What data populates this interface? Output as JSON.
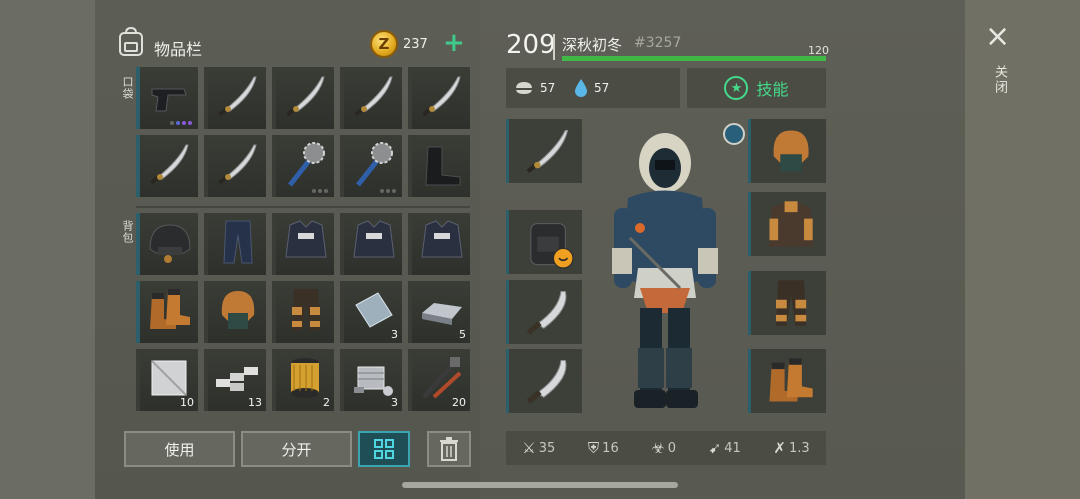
{
  "inventory": {
    "title": "物品栏",
    "coin_symbol": "Z",
    "coins": "237",
    "add_symbol": "+",
    "pocket_label": "口袋",
    "backpack_label": "背包",
    "pocket_items": [
      {
        "icon": "pistol-icon",
        "count": "",
        "dots": [
          "#666",
          "#5a6ad8",
          "#8a5ad8",
          "#8a5ad8"
        ]
      },
      {
        "icon": "katana-icon",
        "count": ""
      },
      {
        "icon": "katana-icon",
        "count": ""
      },
      {
        "icon": "katana-icon",
        "count": ""
      },
      {
        "icon": "katana-icon",
        "count": ""
      },
      {
        "icon": "katana-icon",
        "count": ""
      },
      {
        "icon": "katana-icon",
        "count": ""
      },
      {
        "icon": "spiked-mace-icon",
        "count": "",
        "dots": [
          "#666",
          "#666",
          "#666"
        ]
      },
      {
        "icon": "spiked-mace-icon",
        "count": "",
        "dots": [
          "#666",
          "#666",
          "#666"
        ]
      },
      {
        "icon": "boots-icon",
        "count": ""
      }
    ],
    "backpack_items": [
      {
        "icon": "helmet-icon",
        "count": ""
      },
      {
        "icon": "pants-icon",
        "count": ""
      },
      {
        "icon": "vest-icon",
        "count": ""
      },
      {
        "icon": "vest-icon",
        "count": ""
      },
      {
        "icon": "vest-icon",
        "count": ""
      },
      {
        "icon": "fur-boots-icon",
        "count": ""
      },
      {
        "icon": "fur-hat-icon",
        "count": ""
      },
      {
        "icon": "leather-pants-icon",
        "count": ""
      },
      {
        "icon": "metal-plate-icon",
        "count": "3"
      },
      {
        "icon": "steel-ingot-icon",
        "count": "5"
      },
      {
        "icon": "sheet-metal-icon",
        "count": "10"
      },
      {
        "icon": "aluminum-bar-icon",
        "count": "13"
      },
      {
        "icon": "filter-icon",
        "count": "2"
      },
      {
        "icon": "engine-part-icon",
        "count": "3"
      },
      {
        "icon": "tools-icon",
        "count": "20"
      }
    ],
    "use_label": "使用",
    "split_label": "分开"
  },
  "character": {
    "level": "209",
    "name": "深秋初冬",
    "id": "#3257",
    "hp": "120",
    "hp_fraction": 1.0,
    "food": "57",
    "water": "57",
    "skill_label": "技能",
    "left_slots": [
      "katana-icon",
      "backpack-icon",
      "machete-icon",
      "machete-icon"
    ],
    "right_slots": [
      "fur-hat-icon",
      "fur-jacket-icon",
      "leather-pants-icon",
      "fur-boots-icon"
    ],
    "stats": {
      "attack": "35",
      "defense": "16",
      "toxicity": "0",
      "speed": "41",
      "crit": "1.3"
    }
  },
  "close": {
    "symbol": "×",
    "label": "关闭"
  },
  "colors": {
    "accent": "#2b5f6b",
    "hp_bar": "#3fb845",
    "skill_green": "#45d98a",
    "add_green": "#3fc98b",
    "coin_gold": "#e0a81c"
  }
}
